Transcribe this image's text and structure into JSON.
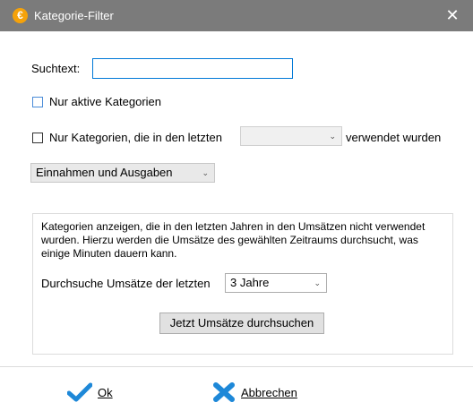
{
  "window": {
    "title": "Kategorie-Filter",
    "close_glyph": "✕",
    "app_icon_glyph": "€"
  },
  "search": {
    "label": "Suchtext:",
    "value": ""
  },
  "active_only": {
    "label": "Nur aktive Kategorien",
    "checked": false
  },
  "recent_filter": {
    "label": "Nur Kategorien, die in den letzten",
    "value": "",
    "suffix": "verwendet wurden",
    "checked": false
  },
  "type_select": {
    "value": "Einnahmen und Ausgaben"
  },
  "unused": {
    "description": "Kategorien anzeigen, die in den letzten Jahren in den Umsätzen nicht verwendet wurden. Hierzu werden die Umsätze des gewählten Zeitraums durchsucht, was einige Minuten dauern kann.",
    "period_label": "Durchsuche Umsätze der letzten",
    "period_value": "3 Jahre",
    "search_button": "Jetzt Umsätze durchsuchen"
  },
  "footer": {
    "ok_label": "Ok",
    "cancel_label": "Abbrechen",
    "ok_icon": "checkmark-icon",
    "cancel_icon": "x-mark-icon"
  },
  "colors": {
    "titlebar": "#7b7b7b",
    "accent": "#0078d7",
    "icon_blue": "#1e88d8"
  }
}
